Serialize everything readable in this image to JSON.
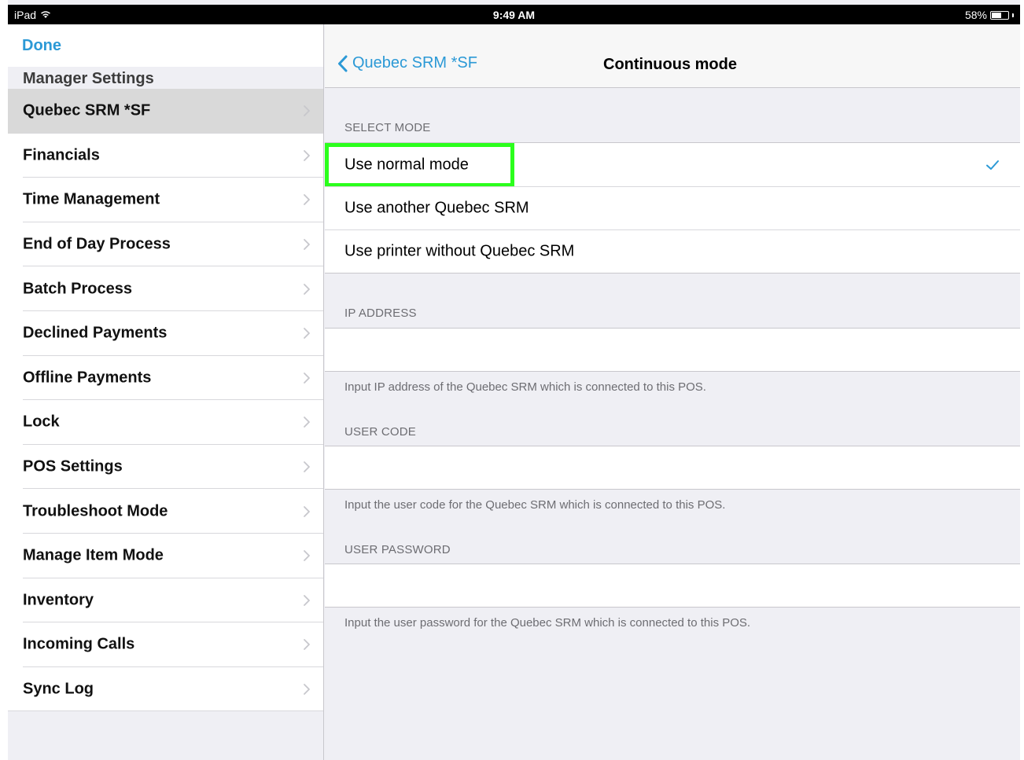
{
  "status_bar": {
    "device": "iPad",
    "time": "9:49 AM",
    "battery": "58%",
    "battery_level": 0.58
  },
  "sidebar": {
    "done_label": "Done",
    "section_title": "Manager Settings",
    "items": [
      {
        "label": "Quebec SRM *SF",
        "selected": true
      },
      {
        "label": "Financials"
      },
      {
        "label": "Time Management"
      },
      {
        "label": "End of Day Process"
      },
      {
        "label": "Batch Process"
      },
      {
        "label": "Declined Payments"
      },
      {
        "label": "Offline Payments"
      },
      {
        "label": "Lock"
      },
      {
        "label": "POS Settings"
      },
      {
        "label": "Troubleshoot Mode"
      },
      {
        "label": "Manage Item Mode"
      },
      {
        "label": "Inventory"
      },
      {
        "label": "Incoming Calls"
      },
      {
        "label": "Sync Log"
      }
    ]
  },
  "detail": {
    "back_label": "Quebec SRM *SF",
    "title": "Continuous mode",
    "select_mode": {
      "header": "SELECT MODE",
      "options": [
        {
          "label": "Use normal mode",
          "checked": true
        },
        {
          "label": "Use another Quebec SRM"
        },
        {
          "label": "Use printer without Quebec SRM"
        }
      ]
    },
    "ip_address": {
      "header": "IP ADDRESS",
      "value": "",
      "footer": "Input IP address of the Quebec SRM which is connected to this POS."
    },
    "user_code": {
      "header": "USER CODE",
      "value": "",
      "footer": "Input the user code for the Quebec SRM which is connected to this POS."
    },
    "user_password": {
      "header": "USER PASSWORD",
      "value": "",
      "footer": "Input the user password for the Quebec SRM which is connected to this POS."
    }
  },
  "colors": {
    "accent": "#2b99d6",
    "highlight": "#2bff1c",
    "background": "#efeff4"
  }
}
